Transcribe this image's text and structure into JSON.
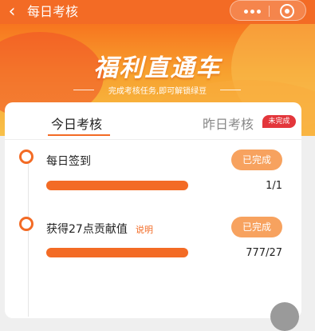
{
  "header": {
    "title": "每日考核",
    "back_icon": "chevron-left-icon"
  },
  "banner": {
    "title": "福利直通车",
    "subtitle": "完成考核任务,即可解锁绿豆"
  },
  "tabs": [
    {
      "label": "今日考核",
      "active": true
    },
    {
      "label": "昨日考核",
      "active": false,
      "badge": "未完成"
    }
  ],
  "tasks": [
    {
      "name": "每日签到",
      "button": "已完成",
      "progress_text": "1/1",
      "progress": 1.0
    },
    {
      "name": "获得27点贡献值",
      "link": "说明",
      "button": "已完成",
      "progress_text": "777/27",
      "progress": 1.0
    }
  ],
  "colors": {
    "accent": "#f36b25",
    "badge": "#e3363b",
    "button": "#f7a25f"
  }
}
